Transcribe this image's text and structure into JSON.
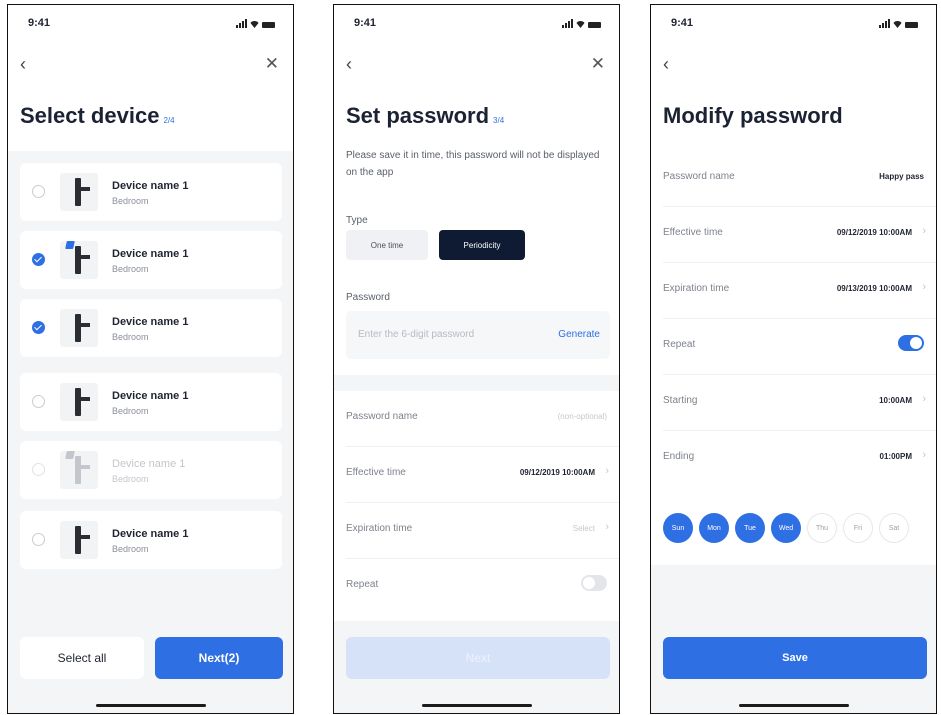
{
  "status_time": "9:41",
  "colors": {
    "accent": "#2f6fe4",
    "dark_chip": "#0e1b33",
    "bg_gray": "#f4f5f7"
  },
  "screen1": {
    "title": "Select device",
    "step": "2/4",
    "devices": [
      {
        "name": "Device name 1",
        "room": "Bedroom",
        "checked": false,
        "disabled": false,
        "tag": false
      },
      {
        "name": "Device name 1",
        "room": "Bedroom",
        "checked": true,
        "disabled": false,
        "tag": true
      },
      {
        "name": "Device name 1",
        "room": "Bedroom",
        "checked": true,
        "disabled": false,
        "tag": false
      },
      {
        "name": "Device name 1",
        "room": "Bedroom",
        "checked": false,
        "disabled": false,
        "tag": false
      },
      {
        "name": "Device name 1",
        "room": "Bedroom",
        "checked": false,
        "disabled": true,
        "tag": true
      },
      {
        "name": "Device name 1",
        "room": "Bedroom",
        "checked": false,
        "disabled": false,
        "tag": false
      }
    ],
    "select_all": "Select all",
    "next": "Next(2)"
  },
  "screen2": {
    "title": "Set password",
    "step": "3/4",
    "description": "Please save it in time, this password will not be displayed on the app",
    "type_label": "Type",
    "type_options": [
      "One time",
      "Periodicity"
    ],
    "password_label": "Password",
    "password_placeholder": "Enter the 6-digit password",
    "generate": "Generate",
    "rows": {
      "name_key": "Password name",
      "name_value": "(non-optional)",
      "effective_key": "Effective time",
      "effective_value": "09/12/2019 10:00AM",
      "expiration_key": "Expiration time",
      "expiration_value": "Select",
      "repeat_key": "Repeat"
    },
    "next": "Next"
  },
  "screen3": {
    "title": "Modify password",
    "rows": {
      "name_key": "Password name",
      "name_value": "Happy pass",
      "effective_key": "Effective time",
      "effective_value": "09/12/2019 10:00AM",
      "expiration_key": "Expiration time",
      "expiration_value": "09/13/2019 10:00AM",
      "repeat_key": "Repeat",
      "starting_key": "Starting",
      "starting_value": "10:00AM",
      "ending_key": "Ending",
      "ending_value": "01:00PM"
    },
    "days": [
      {
        "label": "Sun",
        "on": true
      },
      {
        "label": "Mon",
        "on": true
      },
      {
        "label": "Tue",
        "on": true
      },
      {
        "label": "Wed",
        "on": true
      },
      {
        "label": "Thu",
        "on": false
      },
      {
        "label": "Fri",
        "on": false
      },
      {
        "label": "Sat",
        "on": false
      }
    ],
    "save": "Save"
  }
}
